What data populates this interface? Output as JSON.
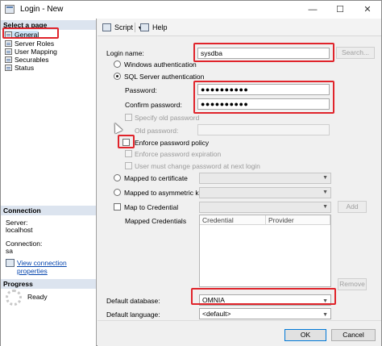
{
  "window": {
    "title": "Login - New"
  },
  "nav": {
    "header": "Select a page",
    "items": [
      "General",
      "Server Roles",
      "User Mapping",
      "Securables",
      "Status"
    ]
  },
  "connection": {
    "header": "Connection",
    "server_label": "Server:",
    "server_value": "localhost",
    "connection_label": "Connection:",
    "connection_value": "sa",
    "view_link": "View connection properties"
  },
  "progress": {
    "header": "Progress",
    "status": "Ready"
  },
  "toolbar": {
    "script_label": "Script",
    "help_label": "Help"
  },
  "form": {
    "login_name_label": "Login name:",
    "login_name_value": "sysdba",
    "search_button": "Search...",
    "windows_auth": "Windows authentication",
    "sql_auth": "SQL Server authentication",
    "password_label": "Password:",
    "password_value": "●●●●●●●●●●",
    "confirm_label": "Confirm password:",
    "confirm_value": "●●●●●●●●●●",
    "specify_old": "Specify old password",
    "old_password_label": "Old password:",
    "enforce_policy": "Enforce password policy",
    "enforce_expiration": "Enforce password expiration",
    "must_change": "User must change password at next login",
    "mapped_cert": "Mapped to certificate",
    "mapped_asym": "Mapped to asymmetric key",
    "map_credential": "Map to Credential",
    "add_button": "Add",
    "mapped_credentials_label": "Mapped Credentials",
    "grid_columns": [
      "Credential",
      "Provider"
    ],
    "remove_button": "Remove",
    "default_db_label": "Default database:",
    "default_db_value": "OMNIA",
    "default_lang_label": "Default language:",
    "default_lang_value": "<default>"
  },
  "footer": {
    "ok_button": "OK",
    "cancel_button": "Cancel"
  },
  "colors": {
    "highlight": "#e0242b",
    "selection": "#cde4f7",
    "link": "#0645ad"
  }
}
